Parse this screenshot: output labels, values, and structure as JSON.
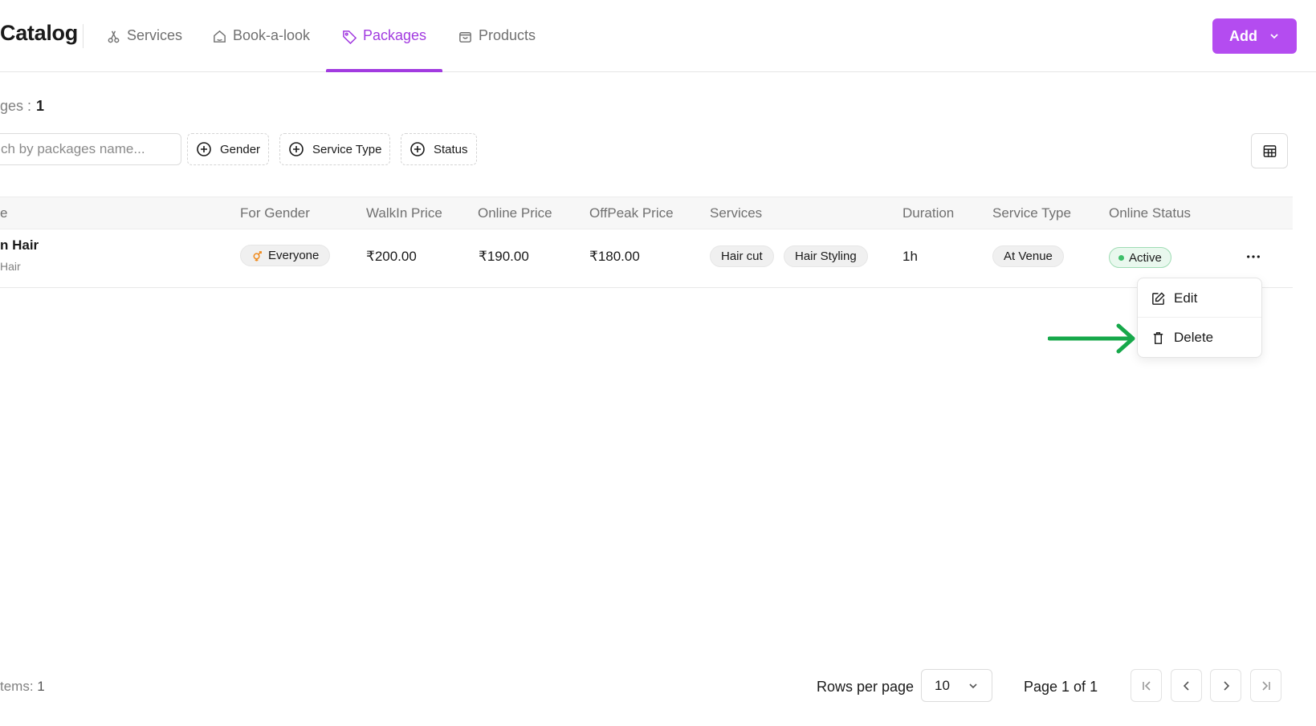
{
  "header": {
    "title": "Catalog",
    "tabs": [
      {
        "label": "Services",
        "icon": "scissors-icon"
      },
      {
        "label": "Book-a-look",
        "icon": "home-icon"
      },
      {
        "label": "Packages",
        "icon": "tag-icon",
        "active": true
      },
      {
        "label": "Products",
        "icon": "bag-icon"
      }
    ],
    "add_label": "Add"
  },
  "summary": {
    "count_label": "ges :",
    "count_value": "1"
  },
  "filters": {
    "search_placeholder": "ch by packages name...",
    "gender_label": "Gender",
    "service_type_label": "Service Type",
    "status_label": "Status"
  },
  "table": {
    "columns": {
      "name": "e",
      "gender": "For Gender",
      "walkin": "WalkIn Price",
      "online": "Online Price",
      "offpeak": "OffPeak Price",
      "services": "Services",
      "duration": "Duration",
      "service_type": "Service Type",
      "online_status": "Online Status"
    },
    "rows": [
      {
        "name": "n Hair",
        "subtitle": "Hair",
        "gender": "Everyone",
        "walkin": "₹200.00",
        "online": "₹190.00",
        "offpeak": "₹180.00",
        "services": [
          "Hair cut",
          "Hair Styling"
        ],
        "duration": "1h",
        "service_type": "At Venue",
        "status": "Active"
      }
    ]
  },
  "row_menu": {
    "edit_label": "Edit",
    "delete_label": "Delete"
  },
  "footer": {
    "total_label": "tems:",
    "total_value": "1",
    "rows_per_page_label": "Rows per page",
    "rows_per_page_value": "10",
    "page_info": "Page 1 of 1"
  },
  "colors": {
    "accent": "#a23be0",
    "add_button": "#b44cf0",
    "status_active": "#3fbf6a",
    "annotation_arrow": "#16a84a",
    "gender_icon": "#f08a1c"
  }
}
